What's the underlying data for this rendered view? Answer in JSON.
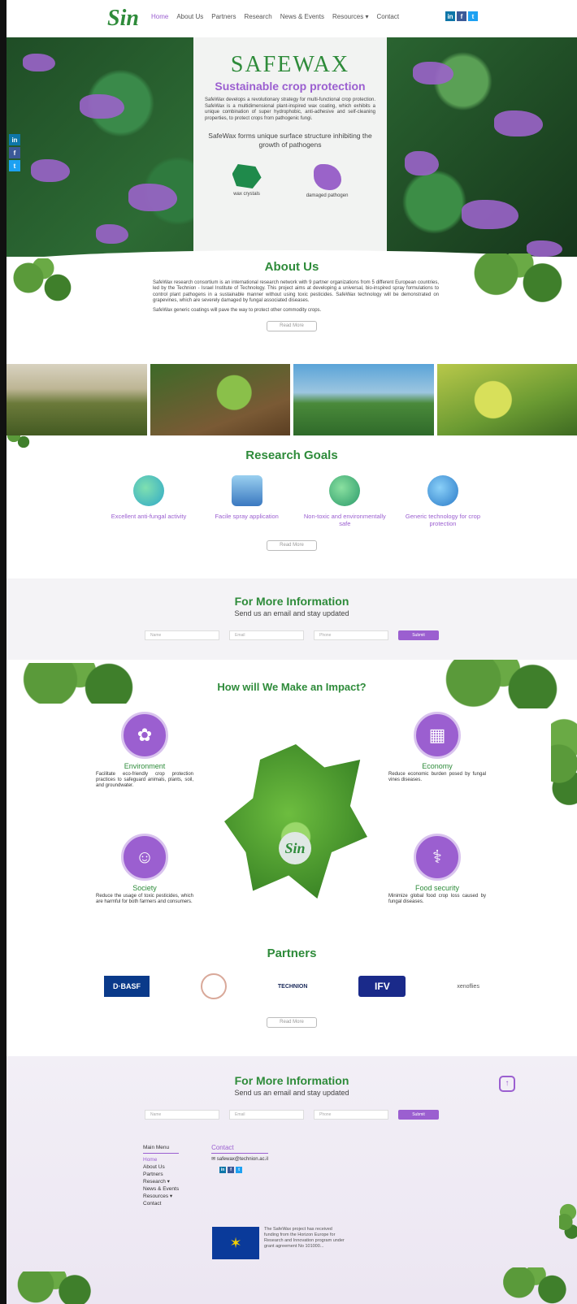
{
  "nav": {
    "logo": "Sin",
    "links": [
      "Home",
      "About Us",
      "Partners",
      "Research",
      "News & Events",
      "Resources ▾",
      "Contact"
    ],
    "social": [
      "in",
      "f",
      "t"
    ]
  },
  "hero": {
    "brand": "SAFEWAX",
    "subtitle": "Sustainable crop protection",
    "paragraph": "SafeWax develops a revolutionary strategy for multi-functional crop protection. SafeWax is a multidimensional plant-inspired wax coating, which exhibits a unique combination of super hydrophobic, anti-adhesive and self-cleaning properties, to protect crops from pathogenic fungi.",
    "tagline": "SafeWax forms unique surface structure inhibiting the growth of pathogens",
    "icon1_label": "wax crystals",
    "icon2_label": "damaged pathogen"
  },
  "about": {
    "title": "About Us",
    "p1": "SafeWax research consortium is an international research network with 9 partner organizations from 5 different European countries, led by the Technion - Israel Institute of Technology. This project aims at developing a universal, bio-inspired spray formulations to control plant pathogens in a sustainable manner without using toxic pesticides. SafeWax technology will be demonstrated on grapevines, which are severely damaged by fungal associated diseases.",
    "p2": "SafeWax generic coatings will pave the way to protect other commodity crops.",
    "button": "Read More"
  },
  "goals": {
    "title": "Research Goals",
    "items": [
      "Excellent anti-fungal activity",
      "Facile spray application",
      "Non-toxic and environmentally safe",
      "Generic technology for crop protection"
    ],
    "button": "Read More"
  },
  "form1": {
    "title": "For More Information",
    "subtitle": "Send us an email and stay updated",
    "name_ph": "Name",
    "email_ph": "Email",
    "phone_ph": "Phone",
    "submit": "Submit"
  },
  "impact": {
    "title": "How will We Make an Impact?",
    "environment": {
      "head": "Environment",
      "text": "Facilitate eco-friendly crop protection practices to safeguard animals, plants, soil, and groundwater."
    },
    "economy": {
      "head": "Economy",
      "text": "Reduce economic burden posed by fungal vines diseases."
    },
    "society": {
      "head": "Society",
      "text": "Reduce the usage of toxic pesticides, which are harmful for both farmers and consumers."
    },
    "food": {
      "head": "Food security",
      "text": "Minimize global food crop loss caused by fungal diseases."
    },
    "leaf_logo": "Sin"
  },
  "partners": {
    "title": "Partners",
    "basf": "D·BASF",
    "technion": "TECHNION",
    "ifv": "IFV",
    "xeno": "xenoflies",
    "button": "Read More"
  },
  "footer": {
    "title": "For More Information",
    "subtitle": "Send us an email and stay updated",
    "name_ph": "Name",
    "email_ph": "Email",
    "phone_ph": "Phone",
    "submit": "Submit",
    "menu_title": "Main Menu",
    "menu": [
      "Home",
      "About Us",
      "Partners",
      "Research ▾",
      "News & Events",
      "Resources ▾",
      "Contact"
    ],
    "contact_title": "Contact",
    "contact_email": "✉ safewax@technion.ac.il",
    "eu_text": "The SafeWax project has received funding from the Horizon Europe for Research and Innovation program under grant agreement No 101000..."
  },
  "colors": {
    "accent": "#9b5fd0",
    "green": "#2e8b3a"
  }
}
